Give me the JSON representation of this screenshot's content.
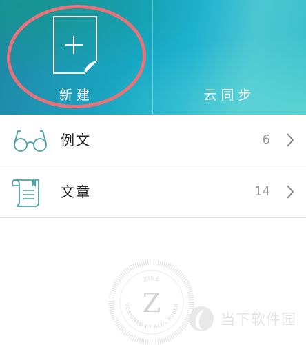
{
  "banner": {
    "new_label": "新建",
    "sync_label": "云同步"
  },
  "list": [
    {
      "title": "例文",
      "count": "6"
    },
    {
      "title": "文章",
      "count": "14"
    }
  ],
  "logo": {
    "letter": "Z",
    "top_text": "ZINE",
    "ring_text": "DESIGNED BY ALEX RUBER"
  },
  "watermark": {
    "text": "当下软件园"
  },
  "colors": {
    "banner_start": "#1f86a6",
    "banner_end": "#39bfcb",
    "highlight_ring": "#e6737a",
    "icon_teal": "#4aa3a8"
  }
}
